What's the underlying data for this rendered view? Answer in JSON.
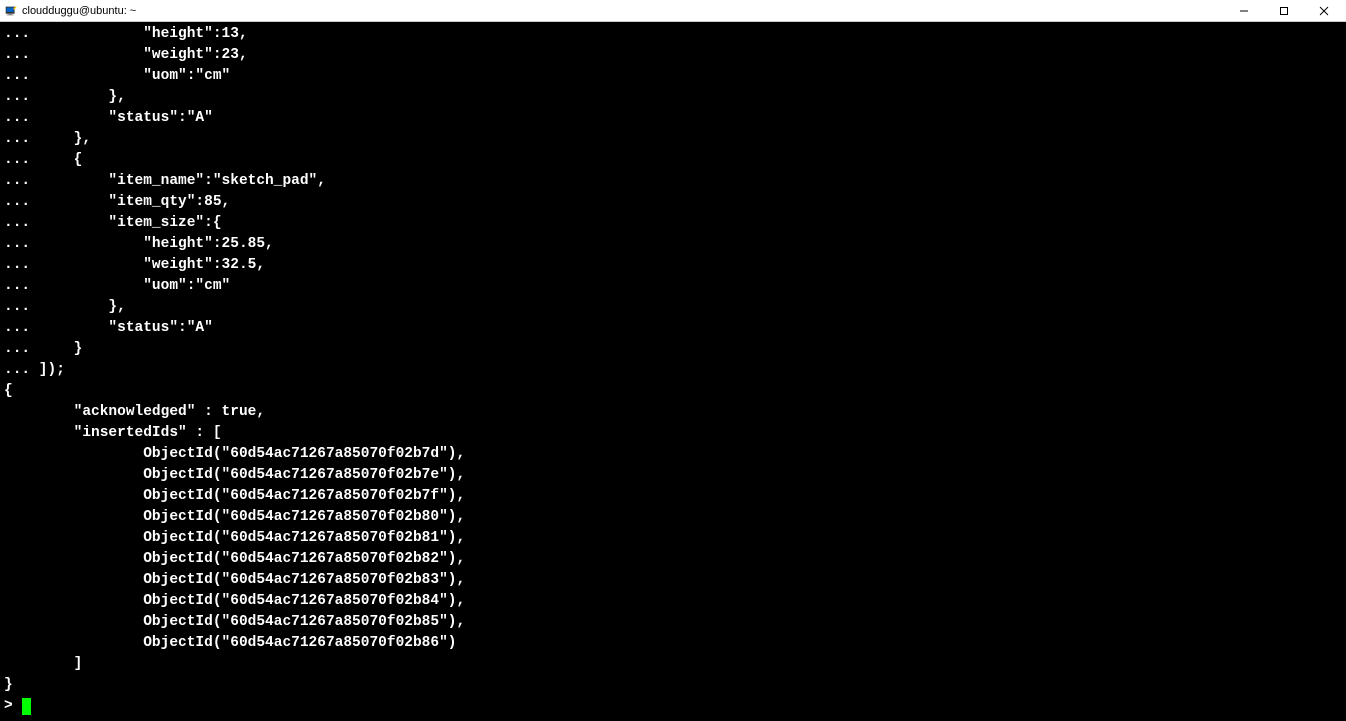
{
  "window": {
    "title": "cloudduggu@ubuntu: ~"
  },
  "terminal": {
    "lines": [
      "...             \"height\":13,",
      "...             \"weight\":23,",
      "...             \"uom\":\"cm\"",
      "...         },",
      "...         \"status\":\"A\"",
      "...     },",
      "...     {",
      "...         \"item_name\":\"sketch_pad\",",
      "...         \"item_qty\":85,",
      "...         \"item_size\":{",
      "...             \"height\":25.85,",
      "...             \"weight\":32.5,",
      "...             \"uom\":\"cm\"",
      "...         },",
      "...         \"status\":\"A\"",
      "...     }",
      "... ]);",
      "{",
      "        \"acknowledged\" : true,",
      "        \"insertedIds\" : [",
      "                ObjectId(\"60d54ac71267a85070f02b7d\"),",
      "                ObjectId(\"60d54ac71267a85070f02b7e\"),",
      "                ObjectId(\"60d54ac71267a85070f02b7f\"),",
      "                ObjectId(\"60d54ac71267a85070f02b80\"),",
      "                ObjectId(\"60d54ac71267a85070f02b81\"),",
      "                ObjectId(\"60d54ac71267a85070f02b82\"),",
      "                ObjectId(\"60d54ac71267a85070f02b83\"),",
      "                ObjectId(\"60d54ac71267a85070f02b84\"),",
      "                ObjectId(\"60d54ac71267a85070f02b85\"),",
      "                ObjectId(\"60d54ac71267a85070f02b86\")",
      "        ]",
      "}"
    ],
    "prompt": "> "
  }
}
